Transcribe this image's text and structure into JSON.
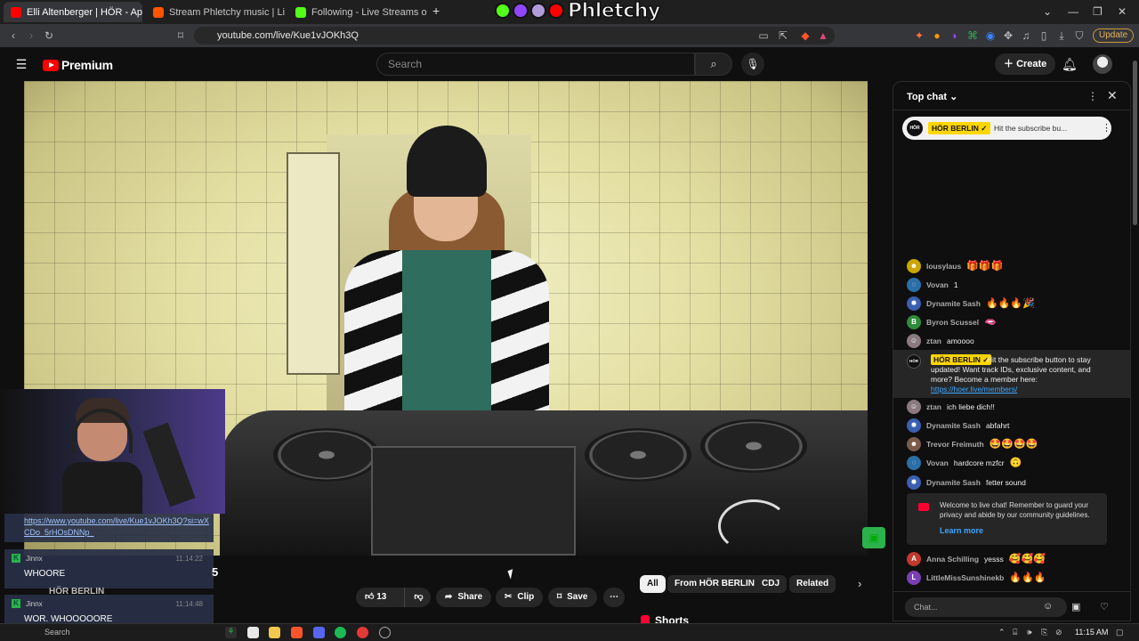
{
  "browser": {
    "tabs": [
      {
        "label": "Elli Altenberger | HÖR - Apr",
        "active": true,
        "color": "#ff0000"
      },
      {
        "label": "Stream Phletchy music | Listen to so",
        "active": false,
        "color": "#ff5500"
      },
      {
        "label": "Following - Live Streams on Kick",
        "active": false,
        "color": "#53fc18"
      }
    ],
    "url": "youtube.com/live/Kue1vJOKh3Q",
    "update_label": "Update"
  },
  "overlay_logo": {
    "text": "Phletchy"
  },
  "youtube": {
    "brand": "Premium",
    "search_placeholder": "Search",
    "create_label": "Create"
  },
  "below_video": {
    "title_fragment": "5",
    "like_count": "13",
    "share_label": "Share",
    "clip_label": "Clip",
    "save_label": "Save",
    "chips": [
      {
        "label": "All",
        "selected": true
      },
      {
        "label": "From HÖR BERLIN",
        "selected": false
      },
      {
        "label": "CDJ",
        "selected": false
      },
      {
        "label": "Related",
        "selected": false
      }
    ],
    "shorts_label": "Shorts"
  },
  "stream_overlay": {
    "link": "https://www.youtube.com/live/Kue1vJOKh3Q?si=wXCDo_5rHOsDNNp_",
    "messages": [
      {
        "user": "Jinnx",
        "time": "11:14:22",
        "text": "WHOORE"
      },
      {
        "user": "Jinnx",
        "time": "11:14:48",
        "text": "WOR. WHOOOOORE"
      }
    ],
    "ghost_text": "HÖR BERLIN"
  },
  "chat": {
    "title": "Top chat",
    "pinned": {
      "name": "HÖR BERLIN ✓",
      "text": "Hit the subscribe bu..."
    },
    "messages": [
      {
        "name": "lousylaus",
        "text": "",
        "emoji": "🎁🎁🎁",
        "av_color": "#c9a600"
      },
      {
        "name": "Vovan",
        "text": "1",
        "emoji": "",
        "av_color": "#2b6fa8"
      },
      {
        "name": "Dynamite Sash",
        "text": "",
        "emoji": "🔥🔥🔥🎉",
        "av_color": "#3a5fb0"
      },
      {
        "name": "Byron Scussel",
        "text": "",
        "emoji": "🫦",
        "av_color": "#2e8b3c",
        "initial": "B"
      },
      {
        "name": "ztan",
        "text": "amoooo",
        "emoji": "",
        "av_color": "#8a7a80"
      },
      {
        "name": "ztan",
        "text": "ich liebe dich!!",
        "emoji": "",
        "av_color": "#8a7a80"
      },
      {
        "name": "Dynamite Sash",
        "text": "abfahrt",
        "emoji": "",
        "av_color": "#3a5fb0"
      },
      {
        "name": "Trevor Freimuth",
        "text": "",
        "emoji": "🤩🤩🤩🤩",
        "av_color": "#7a5a4a"
      },
      {
        "name": "Vovan",
        "text": "hardcore mzfcr",
        "emoji": "🙃",
        "av_color": "#2b6fa8"
      },
      {
        "name": "Dynamite Sash",
        "text": "fetter sound",
        "emoji": "",
        "av_color": "#3a5fb0"
      },
      {
        "name": "Anna Schilling",
        "text": "yesss",
        "emoji": "🥰🥰🥰",
        "av_color": "#c0392b",
        "initial": "A"
      },
      {
        "name": "LittleMissSunshinekb",
        "text": "",
        "emoji": "🔥🔥🔥",
        "av_color": "#7b3fb5",
        "initial": "L"
      }
    ],
    "mod_message": {
      "name": "HÖR BERLIN ✓",
      "text": "Hit the subscribe button to stay updated! Want track IDs, exclusive content, and more? Become a member here: ",
      "link": "https://hoer.live/members/"
    },
    "welcome": {
      "text": "Welcome to live chat! Remember to guard your privacy and abide by our community guidelines.",
      "link": "Learn more"
    },
    "input_placeholder": "Chat..."
  },
  "taskbar": {
    "search": "Search",
    "clock": "11:15 AM"
  }
}
